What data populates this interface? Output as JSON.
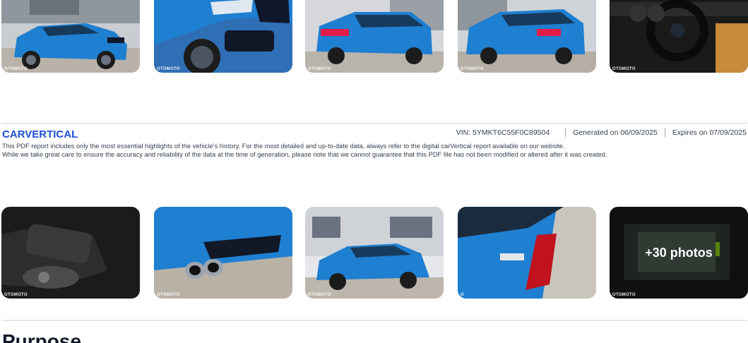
{
  "gallery_top": {
    "photos": [
      {
        "alt": "front-left exterior",
        "watermark": "OTOMOTO"
      },
      {
        "alt": "front bumper close-up",
        "watermark": "OTOMOTO"
      },
      {
        "alt": "rear-left exterior",
        "watermark": "OTOMOTO"
      },
      {
        "alt": "rear three-quarter exterior",
        "watermark": "OTOMOTO"
      },
      {
        "alt": "interior dashboard",
        "watermark": "OTOMOTO"
      }
    ]
  },
  "footer": {
    "brand": "CARVERTICAL",
    "vin_label": "VIN:",
    "vin": "5YMKT6C55F0C89504",
    "generated_label": "Generated on",
    "generated": "06/09/2025",
    "expires_label": "Expires on",
    "expires": "07/09/2025",
    "disclaimer_line1": "This PDF report includes only the most essential highlights of the vehicle’s history. For the most detailed and up-to-date data, always refer to the digital carVertical report available on our website.",
    "disclaimer_line2": "While we take great care to ensure the accuracy and reliability of the data at the time of generation, please note that we cannot guarantee that this PDF file has not been modified or altered after it was created."
  },
  "gallery_bottom": {
    "photos": [
      {
        "alt": "speaker close-up",
        "watermark": "OTOMOTO"
      },
      {
        "alt": "rear diffuser exhausts",
        "watermark": "OTOMOTO"
      },
      {
        "alt": "front-left exterior in lot",
        "watermark": "OTOMOTO"
      },
      {
        "alt": "X5 M badge on tail light",
        "watermark": "O"
      },
      {
        "alt": "infotainment screen",
        "watermark": "OTOMOTO"
      }
    ],
    "more_label": "+30 photos"
  },
  "section": {
    "title": "Purpose"
  },
  "colors": {
    "brand_blue": "#1d4ed8",
    "car_blue": "#1f7fd1"
  }
}
